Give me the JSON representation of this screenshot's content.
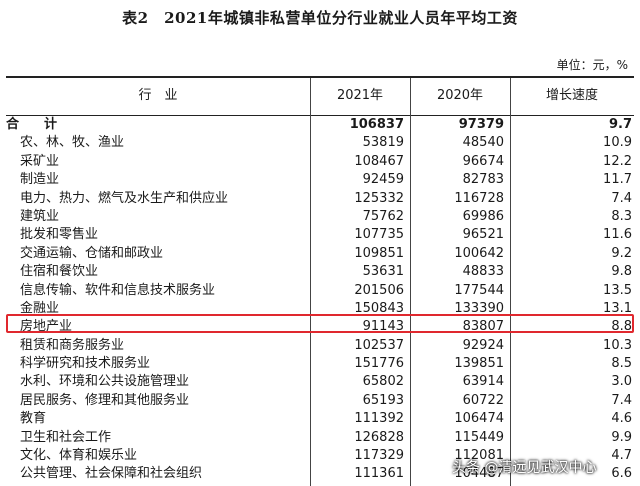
{
  "title": "表2　2021年城镇非私营单位分行业就业人员年平均工资",
  "unit": "单位：元，%",
  "header": {
    "industry": "行　业",
    "y2021": "2021年",
    "y2020": "2020年",
    "growth": "增长速度"
  },
  "rows": [
    {
      "name": "合　计",
      "y2021": "106837",
      "y2020": "97379",
      "growth": "9.7"
    },
    {
      "name": "农、林、牧、渔业",
      "y2021": "53819",
      "y2020": "48540",
      "growth": "10.9"
    },
    {
      "name": "采矿业",
      "y2021": "108467",
      "y2020": "96674",
      "growth": "12.2"
    },
    {
      "name": "制造业",
      "y2021": "92459",
      "y2020": "82783",
      "growth": "11.7"
    },
    {
      "name": "电力、热力、燃气及水生产和供应业",
      "y2021": "125332",
      "y2020": "116728",
      "growth": "7.4"
    },
    {
      "name": "建筑业",
      "y2021": "75762",
      "y2020": "69986",
      "growth": "8.3"
    },
    {
      "name": "批发和零售业",
      "y2021": "107735",
      "y2020": "96521",
      "growth": "11.6"
    },
    {
      "name": "交通运输、仓储和邮政业",
      "y2021": "109851",
      "y2020": "100642",
      "growth": "9.2"
    },
    {
      "name": "住宿和餐饮业",
      "y2021": "53631",
      "y2020": "48833",
      "growth": "9.8"
    },
    {
      "name": "信息传输、软件和信息技术服务业",
      "y2021": "201506",
      "y2020": "177544",
      "growth": "13.5"
    },
    {
      "name": "金融业",
      "y2021": "150843",
      "y2020": "133390",
      "growth": "13.1"
    },
    {
      "name": "房地产业",
      "y2021": "91143",
      "y2020": "83807",
      "growth": "8.8"
    },
    {
      "name": "租赁和商务服务业",
      "y2021": "102537",
      "y2020": "92924",
      "growth": "10.3"
    },
    {
      "name": "科学研究和技术服务业",
      "y2021": "151776",
      "y2020": "139851",
      "growth": "8.5"
    },
    {
      "name": "水利、环境和公共设施管理业",
      "y2021": "65802",
      "y2020": "63914",
      "growth": "3.0"
    },
    {
      "name": "居民服务、修理和其他服务业",
      "y2021": "65193",
      "y2020": "60722",
      "growth": "7.4"
    },
    {
      "name": "教育",
      "y2021": "111392",
      "y2020": "106474",
      "growth": "4.6"
    },
    {
      "name": "卫生和社会工作",
      "y2021": "126828",
      "y2020": "115449",
      "growth": "9.9"
    },
    {
      "name": "文化、体育和娱乐业",
      "y2021": "117329",
      "y2020": "112081",
      "growth": "4.7"
    },
    {
      "name": "公共管理、社会保障和社会组织",
      "y2021": "111361",
      "y2020": "104487",
      "growth": "6.6"
    }
  ],
  "highlight_color": "#e0282e",
  "watermark": "头条 @清远见武汉中心"
}
